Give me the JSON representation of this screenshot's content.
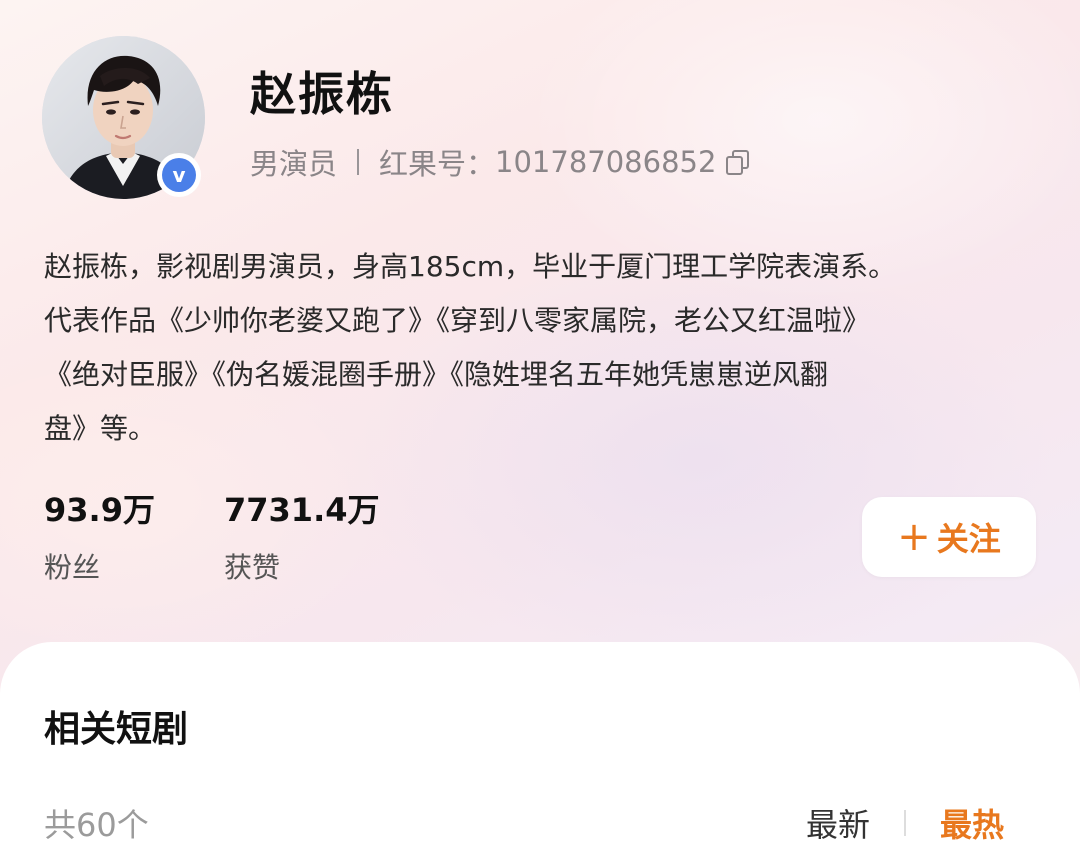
{
  "profile": {
    "name": "赵振栋",
    "role": "男演员",
    "id_label": "红果号：",
    "id_value": "101787086852",
    "avatar_icon": "person-avatar",
    "verified_mark": "v",
    "copy_icon": "copy-icon"
  },
  "bio": {
    "lines": [
      "赵振栋，影视剧男演员，身高185cm，毕业于厦门理工学院表演系。",
      "代表作品《少帅你老婆又跑了》《穿到八零家属院，老公又红温啦》",
      "《绝对臣服》《伪名媛混圈手册》《隐姓埋名五年她凭崽崽逆风翻",
      "盘》等。"
    ]
  },
  "stats": {
    "fans": {
      "value": "93.9万",
      "label": "粉丝"
    },
    "likes": {
      "value": "7731.4万",
      "label": "获赞"
    }
  },
  "follow_button": {
    "plus": "+",
    "label": "关注"
  },
  "related": {
    "title": "相关短剧",
    "count": "共60个",
    "sort_newest": "最新",
    "sort_hottest": "最热"
  },
  "colors": {
    "accent": "#e8781e",
    "verified_blue": "#4a7fe8",
    "muted_text": "#8a8588"
  }
}
